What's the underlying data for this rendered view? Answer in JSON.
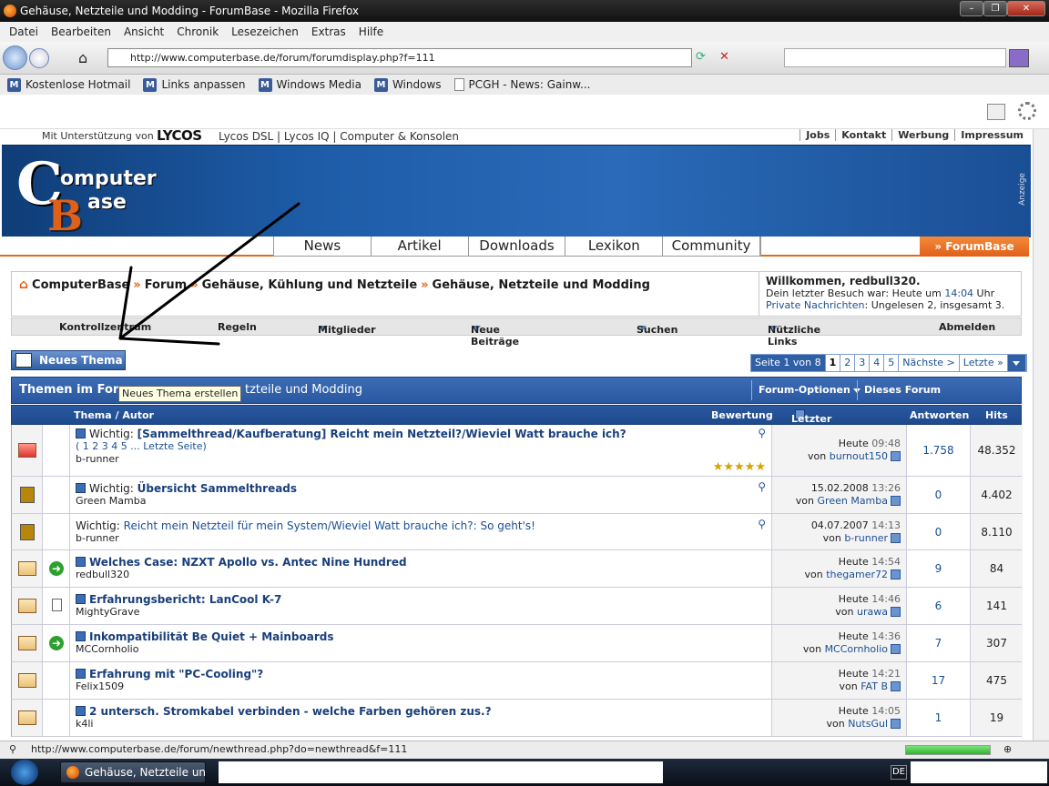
{
  "window": {
    "title": "Gehäuse, Netzteile und Modding - ForumBase - Mozilla Firefox"
  },
  "menu": [
    "Datei",
    "Bearbeiten",
    "Ansicht",
    "Chronik",
    "Lesezeichen",
    "Extras",
    "Hilfe"
  ],
  "url": "http://www.computerbase.de/forum/forumdisplay.php?f=111",
  "bookmarks": [
    "Kostenlose Hotmail",
    "Links anpassen",
    "Windows Media",
    "Windows",
    "PCGH - News: Gainw..."
  ],
  "lycos": {
    "prefix": "Mit Unterstützung von",
    "brand": "LYCOS",
    "links": "Lycos DSL | Lycos IQ | Computer & Konsolen"
  },
  "toplinks": [
    "Jobs",
    "Kontakt",
    "Werbung",
    "Impressum"
  ],
  "logo": {
    "c": "C",
    "omputer": "omputer",
    "b": "B",
    "ase": "ase"
  },
  "anzeige": "Anzeige",
  "mainnav": [
    "News",
    "Artikel",
    "Downloads",
    "Lexikon",
    "Community"
  ],
  "forumbase_tag": "» ForumBase",
  "breadcrumb": [
    "ComputerBase",
    "Forum",
    "Gehäuse, Kühlung und Netzteile",
    "Gehäuse, Netzteile und Modding"
  ],
  "breadcrumb_sep": "»",
  "welcome": {
    "title": "Willkommen, redbull320.",
    "line2_a": "Dein letzter Besuch war: Heute um ",
    "line2_time": "14:04",
    "line2_b": " Uhr",
    "pm_label": "Private Nachrichten",
    "pm_rest": ": Ungelesen 2, insgesamt 3."
  },
  "navrow": [
    "Kontrollzentrum",
    "Regeln",
    "Mitglieder",
    "Neue Beiträge",
    "Suchen",
    "Nützliche Links",
    "Abmelden"
  ],
  "new_thread_button": "Neues Thema",
  "tooltip": "Neues Thema erstellen",
  "pager": {
    "info": "Seite 1 von 8",
    "pages": [
      "1",
      "2",
      "3",
      "4",
      "5"
    ],
    "next": "Nächste >",
    "last": "Letzte »"
  },
  "table": {
    "title_a": "Themen im For",
    "title_b": "tzteile und Modding",
    "options": "Forum-Optionen",
    "search": "Dieses Forum durchsuchen",
    "col_thema": "Thema / Autor",
    "col_bewertung": "Bewertung",
    "col_last": "Letzter Beitrag",
    "col_answers": "Antworten",
    "col_hits": "Hits"
  },
  "threads": [
    {
      "prefix": "Wichtig: ",
      "title": "[Sammelthread/Kaufberatung] Reicht mein Netzteil?/Wieviel Watt brauche ich?",
      "pages": "( 1 2 3 4 5 ... Letzte Seite)",
      "author": "b-runner",
      "date": "Heute",
      "time": "09:48",
      "by": "burnout150",
      "answers": "1.758",
      "hits": "48.352",
      "rating": "★★★★★"
    },
    {
      "prefix": "Wichtig: ",
      "title": "Übersicht Sammelthreads",
      "author": "Green Mamba",
      "date": "15.02.2008",
      "time": "13:26",
      "by": "Green Mamba",
      "answers": "0",
      "hits": "4.402"
    },
    {
      "prefix": "Wichtig: ",
      "title": "Reicht mein Netzteil für mein System/Wieviel Watt brauche ich?: So geht's!",
      "author": "b-runner",
      "date": "04.07.2007",
      "time": "14:13",
      "by": "b-runner",
      "answers": "0",
      "hits": "8.110"
    },
    {
      "title": "Welches Case: NZXT Apollo vs. Antec Nine Hundred",
      "author": "redbull320",
      "date": "Heute",
      "time": "14:54",
      "by": "thegamer72",
      "answers": "9",
      "hits": "84"
    },
    {
      "title": "Erfahrungsbericht: LanCool K-7",
      "author": "MightyGrave",
      "date": "Heute",
      "time": "14:46",
      "by": "urawa",
      "answers": "6",
      "hits": "141"
    },
    {
      "title": "Inkompatibilität Be Quiet + Mainboards",
      "author": "MCCornholio",
      "date": "Heute",
      "time": "14:36",
      "by": "MCCornholio",
      "answers": "7",
      "hits": "307"
    },
    {
      "title": "Erfahrung mit \"PC-Cooling\"?",
      "author": "Felix1509",
      "date": "Heute",
      "time": "14:21",
      "by": "FAT B",
      "answers": "17",
      "hits": "475"
    },
    {
      "title": "2 untersch. Stromkabel verbinden - welche Farben gehören zus.?",
      "author": "k4li",
      "date": "Heute",
      "time": "14:05",
      "by": "NutsGul",
      "answers": "1",
      "hits": "19"
    }
  ],
  "von": "von",
  "status_url": "http://www.computerbase.de/forum/newthread.php?do=newthread&f=111",
  "taskbar_item": "Gehäuse, Netzteile un...",
  "lang": "DE",
  "colors": {
    "accent": "#e0601a",
    "header_blue": "#2a58a0",
    "link": "#1a4f95"
  }
}
